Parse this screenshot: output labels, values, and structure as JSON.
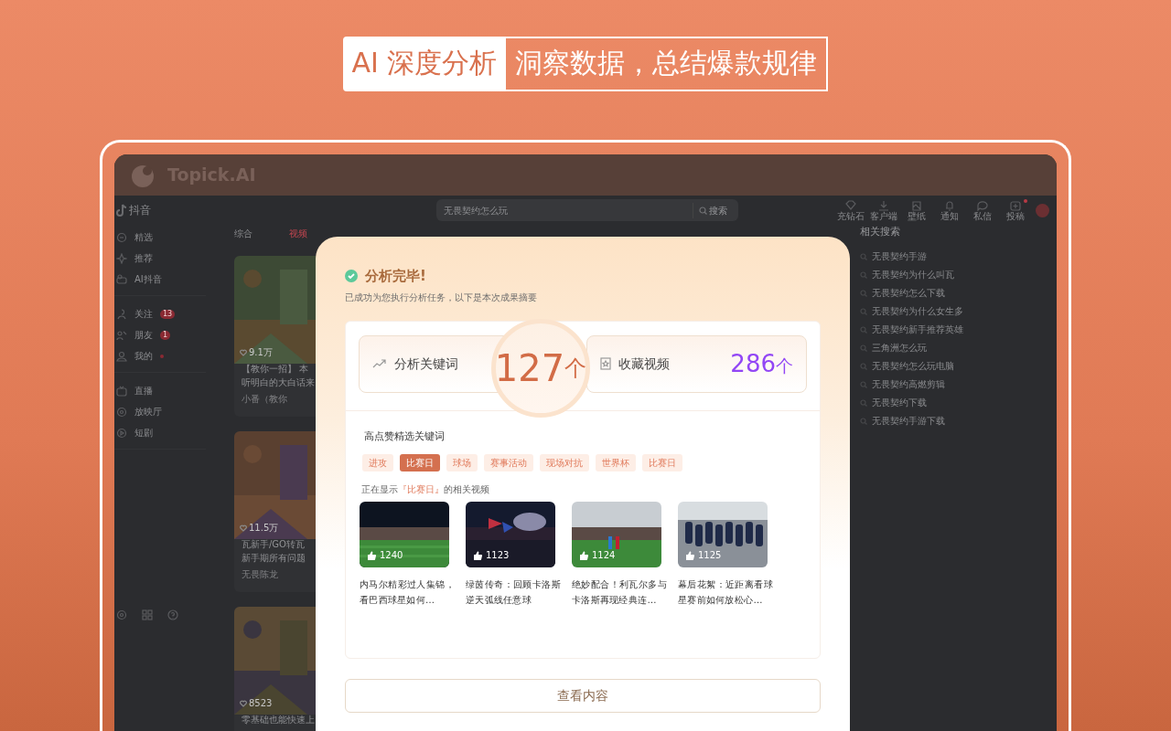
{
  "headline": {
    "highlight": "AI 深度分析",
    "text": "洞察数据，总结爆款规律"
  },
  "app": {
    "name": "Topick.AI"
  },
  "douyin": {
    "logo": "抖音",
    "search": {
      "placeholder": "无畏契约怎么玩",
      "button": "搜索"
    },
    "toolbar": [
      {
        "label": "充钻石",
        "notify": false
      },
      {
        "label": "客户端",
        "notify": false
      },
      {
        "label": "壁纸",
        "notify": false
      },
      {
        "label": "通知",
        "notify": false
      },
      {
        "label": "私信",
        "notify": false
      },
      {
        "label": "投稿",
        "notify": true
      }
    ],
    "sidebar": {
      "groups": [
        {
          "items": [
            {
              "label": "精选",
              "dot": false
            },
            {
              "label": "推荐",
              "dot": false
            },
            {
              "label": "AI抖音",
              "dot": false
            }
          ]
        },
        {
          "items": [
            {
              "label": "关注",
              "badge": "13",
              "dot": false
            },
            {
              "label": "朋友",
              "badge": "1",
              "dot": false
            },
            {
              "label": "我的",
              "dot": true
            }
          ]
        },
        {
          "items": [
            {
              "label": "直播",
              "dot": false
            },
            {
              "label": "放映厅",
              "dot": false
            },
            {
              "label": "短剧",
              "dot": false
            }
          ]
        }
      ]
    },
    "tabs": [
      {
        "label": "综合",
        "selected": false
      },
      {
        "label": "视频",
        "selected": true
      }
    ],
    "cards": [
      {
        "likes": "9.1万",
        "lines": [
          "【教你一招】 本",
          "听明白的大白话来"
        ],
        "author": "小番（教你"
      },
      {
        "likes": "11.5万",
        "lines": [
          "瓦新手/GO转瓦",
          "新手期所有问题"
        ],
        "author": "无畏陈龙"
      },
      {
        "likes": "8523",
        "lines": [
          "零基础也能快速上"
        ]
      }
    ],
    "related": {
      "title": "相关搜索",
      "items": [
        "无畏契约手游",
        "无畏契约为什么叫瓦",
        "无畏契约怎么下载",
        "无畏契约为什么女生多",
        "无畏契约新手推荐英雄",
        "三角洲怎么玩",
        "无畏契约怎么玩电脑",
        "无畏契约高燃剪辑",
        "无畏契约下载",
        "无畏契约手游下载"
      ]
    }
  },
  "dialog": {
    "title": "分析完毕!",
    "subtitle": "已成功为您执行分析任务，以下是本次成果摘要",
    "stats": [
      {
        "label": "分析关键词",
        "value": "127",
        "unit": "个",
        "kind": "highlight"
      },
      {
        "label": "收藏视频",
        "value": "286",
        "unit": "个",
        "kind": "plain"
      }
    ],
    "keywords_title": "高点赞精选关键词",
    "keywords": [
      {
        "label": "进攻",
        "selected": false
      },
      {
        "label": "比赛日",
        "selected": true
      },
      {
        "label": "球场",
        "selected": false
      },
      {
        "label": "赛事活动",
        "selected": false
      },
      {
        "label": "现场对抗",
        "selected": false
      },
      {
        "label": "世界杯",
        "selected": false
      },
      {
        "label": "比赛日",
        "selected": false
      }
    ],
    "showing": {
      "prefix": "正在显示",
      "keyword": "『比赛日』",
      "suffix": "的相关视频"
    },
    "videos": [
      {
        "likes": "1240",
        "title": "内马尔精彩过人集锦，看巴西球星如何…"
      },
      {
        "likes": "1123",
        "title": "绿茵传奇：回顾卡洛斯逆天弧线任意球"
      },
      {
        "likes": "1124",
        "title": "绝妙配合！利瓦尔多与卡洛斯再现经典连…"
      },
      {
        "likes": "1125",
        "title": "幕后花絮：近距离看球星赛前如何放松心…"
      }
    ],
    "button": "查看内容"
  }
}
